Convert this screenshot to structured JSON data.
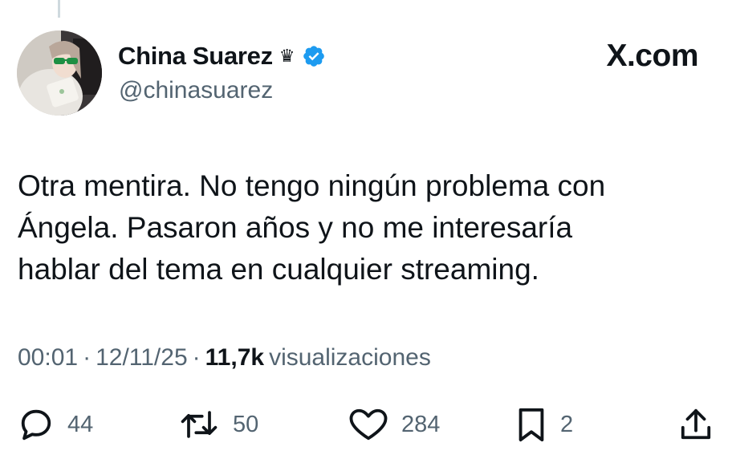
{
  "author": {
    "display_name": "China Suarez",
    "name_glyph": "♛",
    "handle": "@chinasuarez",
    "verified_icon": "verified-badge-icon",
    "verified_color": "#1d9bf0"
  },
  "brand": {
    "label": "X.com"
  },
  "tweet": {
    "lines": [
      "Otra mentira. No tengo ningún problema con",
      "Ángela. Pasaron años y no me interesaría",
      "hablar del tema en cualquier streaming."
    ]
  },
  "meta": {
    "time": "00:01",
    "separator": "·",
    "date": "12/11/25",
    "views_count": "11,7k",
    "views_label": "visualizaciones"
  },
  "actions": {
    "reply": {
      "icon": "reply-icon",
      "count": "44"
    },
    "retweet": {
      "icon": "retweet-icon",
      "count": "50"
    },
    "like": {
      "icon": "heart-icon",
      "count": "284"
    },
    "bookmark": {
      "icon": "bookmark-icon",
      "count": "2"
    },
    "share": {
      "icon": "share-icon"
    }
  },
  "colors": {
    "text_primary": "#0f1419",
    "text_secondary": "#536471",
    "accent": "#1d9bf0"
  }
}
